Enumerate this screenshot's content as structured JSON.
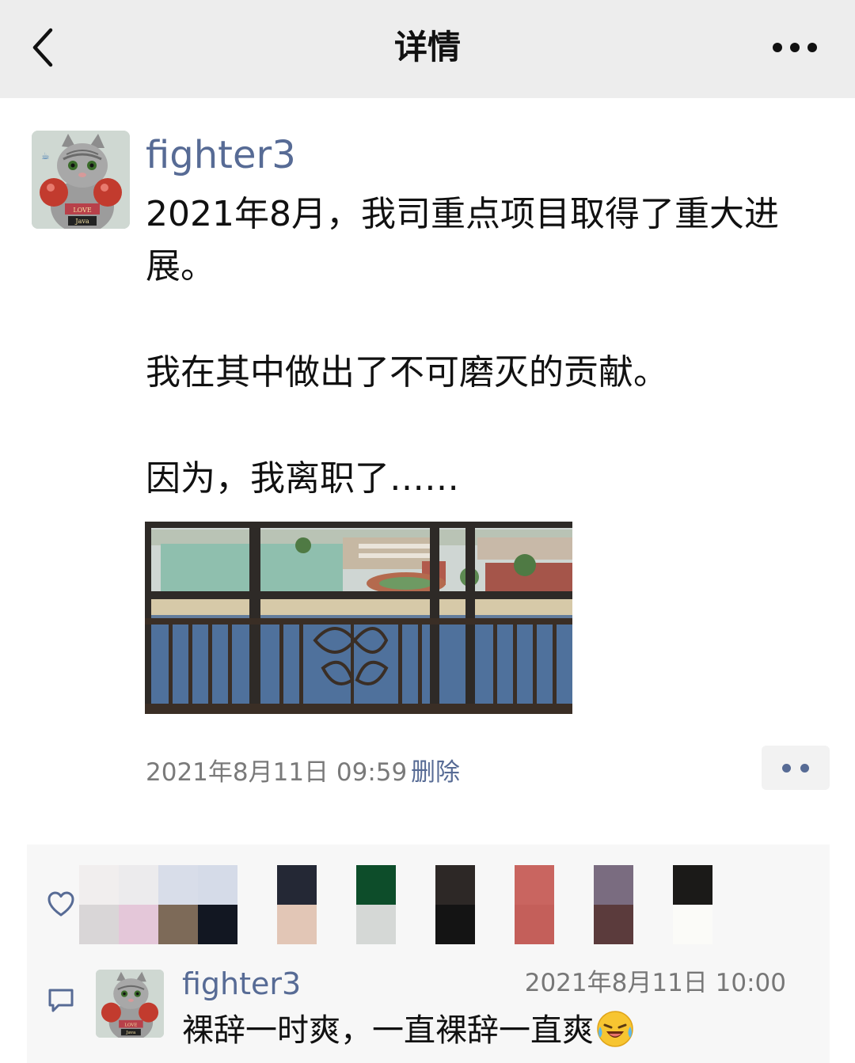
{
  "header": {
    "title": "详情"
  },
  "post": {
    "author": "fighter3",
    "paragraphs": [
      "2021年8月，我司重点项目取得了重大进",
      "展。",
      "我在其中做出了不可磨灭的贡献。",
      "因为，我离职了……"
    ],
    "time": "2021年8月11日 09:59",
    "delete_label": "删除",
    "avatar_text": [
      "LOVE",
      "Java"
    ]
  },
  "likes": {
    "colors": [
      [
        "#f1eeee",
        "#d9d6d7"
      ],
      [
        "#ecebed",
        "#e4c7d9"
      ],
      [
        "#d8dde9",
        "#7d6a58"
      ],
      [
        "#d5dbe8",
        "#121722"
      ],
      [
        "#242835",
        "#e2c6b6"
      ],
      [
        "#0d4d2a",
        "#d5d8d6"
      ],
      [
        "#2d2826",
        "#141414"
      ],
      [
        "#c96560",
        "#c45f5a"
      ],
      [
        "#7a6c80",
        "#5b3b3c"
      ],
      [
        "#1b1a18",
        "#fbfbf8"
      ]
    ]
  },
  "comment": {
    "author": "fighter3",
    "time": "2021年8月11日 10:00",
    "text": "裸辞一时爽，一直裸辞一直爽"
  }
}
